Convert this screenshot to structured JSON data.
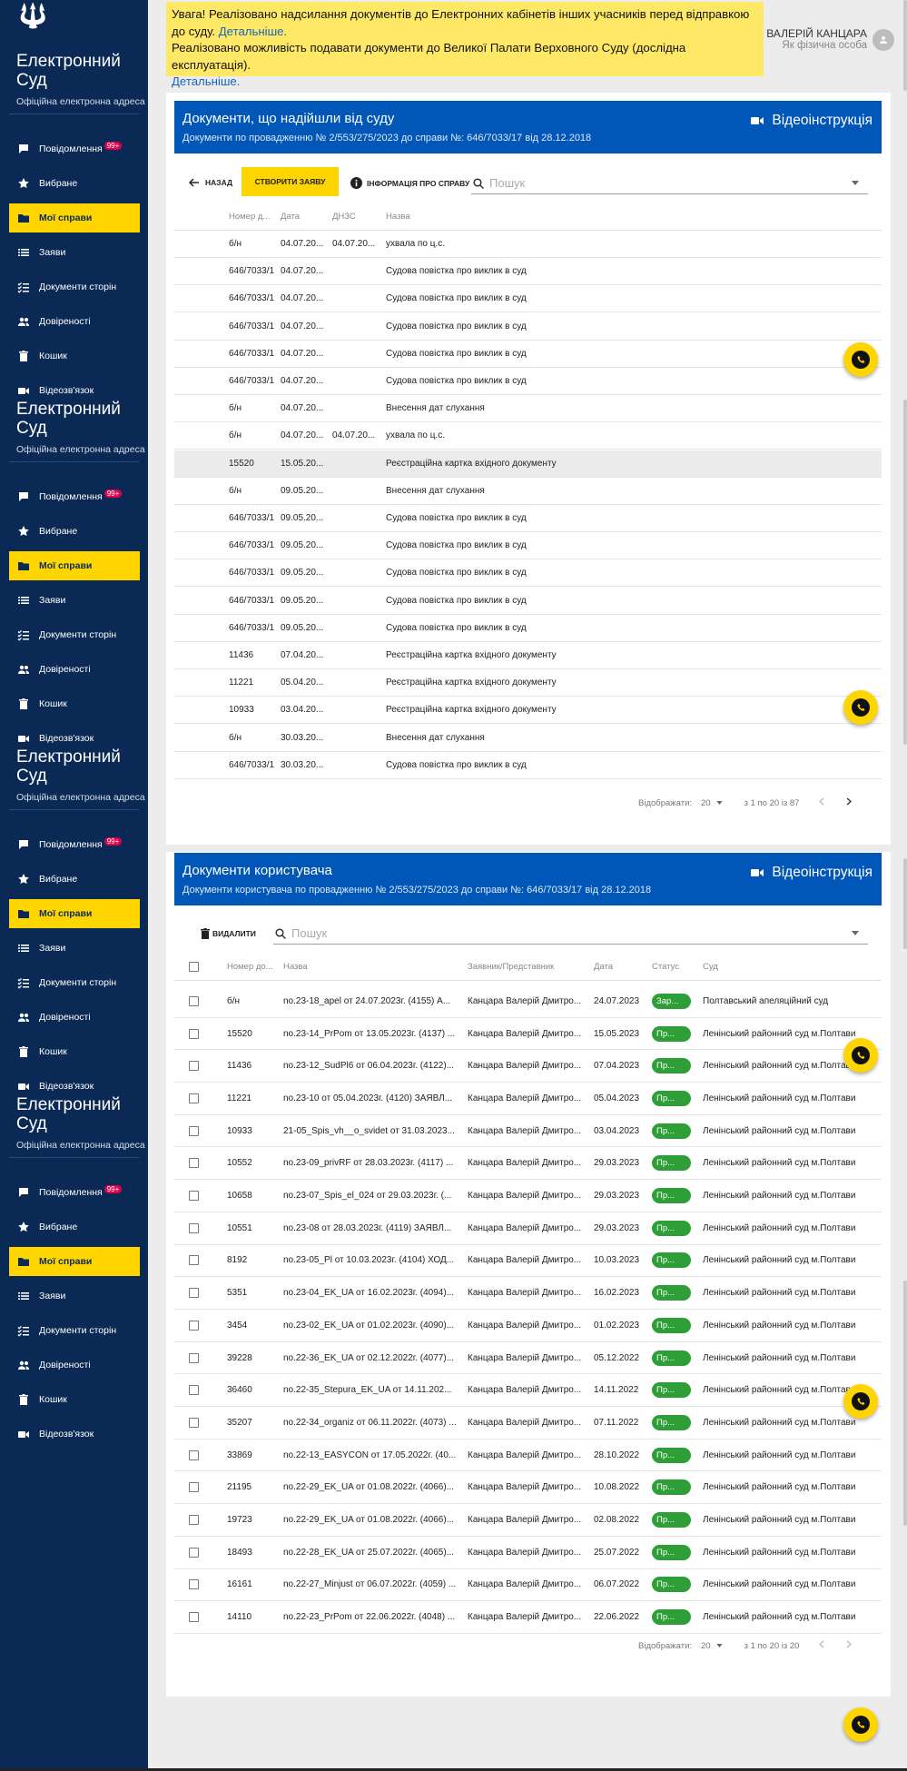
{
  "sidebar": {
    "title": "Електронний Суд",
    "subtitle": "Офіційна електронна адреса",
    "badge": "99+",
    "items": [
      {
        "label": "Повідомлення",
        "icon": "message-icon"
      },
      {
        "label": "Вибране",
        "icon": "star-icon"
      },
      {
        "label": "Мої справи",
        "icon": "folder-icon"
      },
      {
        "label": "Заяви",
        "icon": "list-icon"
      },
      {
        "label": "Документи сторін",
        "icon": "checklist-icon"
      },
      {
        "label": "Довіреності",
        "icon": "people-icon"
      },
      {
        "label": "Кошик",
        "icon": "trash-icon"
      },
      {
        "label": "Відеозв'язок",
        "icon": "video-icon"
      }
    ]
  },
  "notice": {
    "line1": "Увага! Реалізовано надсилання документів до Електронних кабінетів інших учасників перед відправкою до суду.",
    "link1": "Детальніше.",
    "line2": "Реалізовано можливість подавати документи до Великої Палати Верховного Суду (дослідна експлуатація).",
    "link2": "Детальніше."
  },
  "user": {
    "name": "ВАЛЕРІЙ КАНЦАРА",
    "role": "Як фізична особа"
  },
  "court_docs": {
    "title": "Документи, що надійшли від суду",
    "subtitle": "Документи по провадженню № 2/553/275/2023 до справи №: 646/7033/17 від 28.12.2018",
    "video_label": "Відеоінструкція",
    "back_label": "НАЗАД",
    "create_label": "СТВОРИТИ ЗАЯВУ",
    "info_label": "ІНФОРМАЦІЯ ПРО СПРАВУ",
    "search_placeholder": "Пошук",
    "columns": [
      "Номер д...",
      "Дата",
      "ДНЗС",
      "Назва"
    ],
    "rows": [
      [
        "б/н",
        "04.07.20...",
        "04.07.20...",
        "ухвала по ц.с."
      ],
      [
        "646/7033/1",
        "04.07.20...",
        "",
        "Судова повістка про виклик в суд"
      ],
      [
        "646/7033/1",
        "04.07.20...",
        "",
        "Судова повістка про виклик в суд"
      ],
      [
        "646/7033/1",
        "04.07.20...",
        "",
        "Судова повістка про виклик в суд"
      ],
      [
        "646/7033/1",
        "04.07.20...",
        "",
        "Судова повістка про виклик в суд"
      ],
      [
        "646/7033/1",
        "04.07.20...",
        "",
        "Судова повістка про виклик в суд"
      ],
      [
        "б/н",
        "04.07.20...",
        "",
        "Внесення дат слухання"
      ],
      [
        "б/н",
        "04.07.20...",
        "04.07.20...",
        "ухвала по ц.с."
      ],
      [
        "15520",
        "15.05.20...",
        "",
        "Реєстраційна картка вхідного документу"
      ],
      [
        "б/н",
        "09.05.20...",
        "",
        "Внесення дат слухання"
      ],
      [
        "646/7033/1",
        "09.05.20...",
        "",
        "Судова повістка про виклик в суд"
      ],
      [
        "646/7033/1",
        "09.05.20...",
        "",
        "Судова повістка про виклик в суд"
      ],
      [
        "646/7033/1",
        "09.05.20...",
        "",
        "Судова повістка про виклик в суд"
      ],
      [
        "646/7033/1",
        "09.05.20...",
        "",
        "Судова повістка про виклик в суд"
      ],
      [
        "646/7033/1",
        "09.05.20...",
        "",
        "Судова повістка про виклик в суд"
      ],
      [
        "11436",
        "07.04.20...",
        "",
        "Реєстраційна картка вхідного документу"
      ],
      [
        "11221",
        "05.04.20...",
        "",
        "Реєстраційна картка вхідного документу"
      ],
      [
        "10933",
        "03.04.20...",
        "",
        "Реєстраційна картка вхідного документу"
      ],
      [
        "б/н",
        "30.03.20...",
        "",
        "Внесення дат слухання"
      ],
      [
        "646/7033/1",
        "30.03.20...",
        "",
        "Судова повістка про виклик в суд"
      ]
    ],
    "pager": {
      "label": "Відображати:",
      "per_page": "20",
      "range": "з 1 по 20 із 87"
    }
  },
  "user_docs": {
    "title": "Документи користувача",
    "subtitle": "Документи користувача по провадженню № 2/553/275/2023 до справи №: 646/7033/17 від 28.12.2018",
    "video_label": "Відеоінструкція",
    "delete_label": "ВИДАЛИТИ",
    "search_placeholder": "Пошук",
    "columns": [
      "Номер до...",
      "Назва",
      "Заявник/Представник",
      "Дата",
      "Статус",
      "Суд"
    ],
    "rows": [
      [
        "б/н",
        "no.23-18_apel от 24.07.2023г. (4155) А...",
        "Канцара Валерій Дмитро...",
        "24.07.2023",
        "Зар...",
        "Полтавський апеляційний суд"
      ],
      [
        "15520",
        "no.23-14_PrPom от 13.05.2023г. (4137) ...",
        "Канцара Валерій Дмитро...",
        "15.05.2023",
        "Пр...",
        "Ленінський районний суд м.Полтави"
      ],
      [
        "11436",
        "no.23-12_SudPl6 от 06.04.2023г. (4122)...",
        "Канцара Валерій Дмитро...",
        "07.04.2023",
        "Пр...",
        "Ленінський районний суд м.Полтави"
      ],
      [
        "11221",
        "no.23-10 от 05.04.2023г. (4120) ЗАЯВЛ...",
        "Канцара Валерій Дмитро...",
        "05.04.2023",
        "Пр...",
        "Ленінський районний суд м.Полтави"
      ],
      [
        "10933",
        "21-05_Spis_vh__o_svidet от 31.03.2023...",
        "Канцара Валерій Дмитро...",
        "03.04.2023",
        "Пр...",
        "Ленінський районний суд м.Полтави"
      ],
      [
        "10552",
        "no.23-09_privRF от 28.03.2023г. (4117) ...",
        "Канцара Валерій Дмитро...",
        "29.03.2023",
        "Пр...",
        "Ленінський районний суд м.Полтави"
      ],
      [
        "10658",
        "no.23-07_Spis_el_024 от 29.03.2023г. (...",
        "Канцара Валерій Дмитро...",
        "29.03.2023",
        "Пр...",
        "Ленінський районний суд м.Полтави"
      ],
      [
        "10551",
        "no.23-08 от 28.03.2023г. (4119) ЗАЯВЛ...",
        "Канцара Валерій Дмитро...",
        "29.03.2023",
        "Пр...",
        "Ленінський районний суд м.Полтави"
      ],
      [
        "8192",
        "no.23-05_Pl от 10.03.2023г. (4104) ХОД...",
        "Канцара Валерій Дмитро...",
        "10.03.2023",
        "Пр...",
        "Ленінський районний суд м.Полтави"
      ],
      [
        "5351",
        "no.23-04_EK_UA от 16.02.2023г. (4094)...",
        "Канцара Валерій Дмитро...",
        "16.02.2023",
        "Пр...",
        "Ленінський районний суд м.Полтави"
      ],
      [
        "3454",
        "no.23-02_EK_UA от 01.02.2023г. (4090)...",
        "Канцара Валерій Дмитро...",
        "01.02.2023",
        "Пр...",
        "Ленінський районний суд м.Полтави"
      ],
      [
        "39228",
        "no.22-36_EK_UA от 02.12.2022г. (4077)...",
        "Канцара Валерій Дмитро...",
        "05.12.2022",
        "Пр...",
        "Ленінський районний суд м.Полтави"
      ],
      [
        "36460",
        "no.22-35_Stepura_EK_UA от 14.11.202...",
        "Канцара Валерій Дмитро...",
        "14.11.2022",
        "Пр...",
        "Ленінський районний суд м.Полтави"
      ],
      [
        "35207",
        "no.22-34_organiz от 06.11.2022г. (4073) ...",
        "Канцара Валерій Дмитро...",
        "07.11.2022",
        "Пр...",
        "Ленінський районний суд м.Полтави"
      ],
      [
        "33869",
        "no.22-13_EASYCON от 17.05.2022г. (40...",
        "Канцара Валерій Дмитро...",
        "28.10.2022",
        "Пр...",
        "Ленінський районний суд м.Полтави"
      ],
      [
        "21195",
        "no.22-29_EK_UA от 01.08.2022г. (4066)...",
        "Канцара Валерій Дмитро...",
        "10.08.2022",
        "Пр...",
        "Ленінський районний суд м.Полтави"
      ],
      [
        "19723",
        "no.22-29_EK_UA от 01.08.2022г. (4066)...",
        "Канцара Валерій Дмитро...",
        "02.08.2022",
        "Пр...",
        "Ленінський районний суд м.Полтави"
      ],
      [
        "18493",
        "no.22-28_EK_UA от 25.07.2022г. (4065)...",
        "Канцара Валерій Дмитро...",
        "25.07.2022",
        "Пр...",
        "Ленінський районний суд м.Полтави"
      ],
      [
        "16161",
        "no.22-27_Minjust от 06.07.2022г. (4059) ...",
        "Канцара Валерій Дмитро...",
        "06.07.2022",
        "Пр...",
        "Ленінський районний суд м.Полтави"
      ],
      [
        "14110",
        "no.22-23_PrPom от 22.06.2022г. (4048) ...",
        "Канцара Валерій Дмитро...",
        "22.06.2022",
        "Пр...",
        "Ленінський районний суд м.Полтави"
      ]
    ],
    "pager": {
      "label": "Відображати:",
      "per_page": "20",
      "range": "з 1 по 20 із 20"
    }
  },
  "colors": {
    "sidebar": "#0a2a55",
    "accent": "#ffd500",
    "header": "#0057b8",
    "status_green": "#2e9e37",
    "notice": "#ffe866"
  }
}
